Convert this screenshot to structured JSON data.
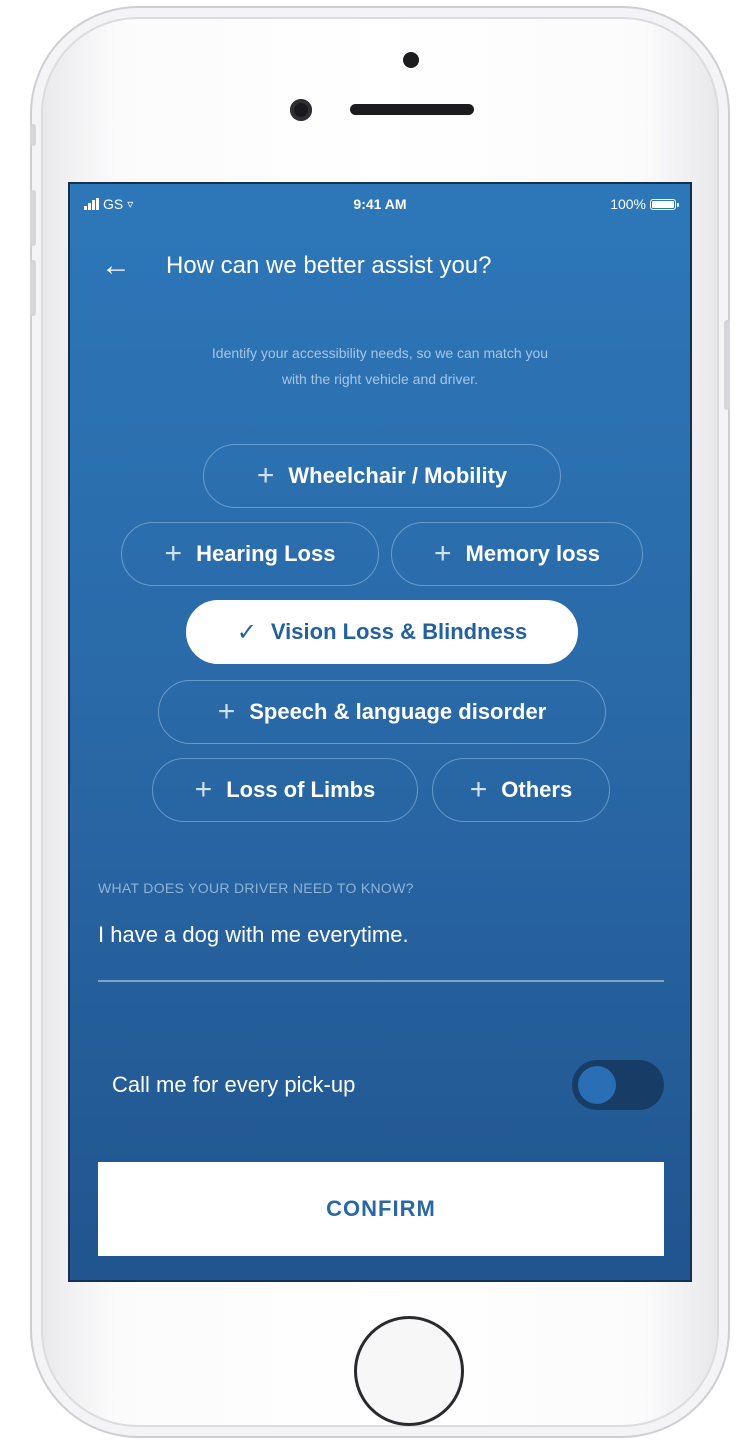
{
  "status_bar": {
    "carrier": "GS",
    "time": "9:41 AM",
    "battery": "100%"
  },
  "header": {
    "back_icon": "arrow-left-icon",
    "title": "How can we better assist you?"
  },
  "intro": {
    "line1": "Identify your accessibility needs, so we can match you",
    "line2": "with the right vehicle and driver."
  },
  "needs": [
    {
      "label": "Wheelchair / Mobility",
      "selected": false
    },
    {
      "label": "Hearing Loss",
      "selected": false
    },
    {
      "label": "Memory loss",
      "selected": false
    },
    {
      "label": "Vision Loss & Blindness",
      "selected": true
    },
    {
      "label": "Speech & language disorder",
      "selected": false
    },
    {
      "label": "Loss of Limbs",
      "selected": false
    },
    {
      "label": "Others",
      "selected": false
    }
  ],
  "driver_note": {
    "label": "WHAT DOES YOUR DRIVER NEED TO KNOW?",
    "value": "I have a dog with me everytime."
  },
  "call_toggle": {
    "label": "Call me for every pick-up",
    "on": false
  },
  "confirm_label": "CONFIRM",
  "colors": {
    "screen_top": "#2d77b9",
    "screen_bottom": "#20558f",
    "accent": "#2a67a6"
  }
}
